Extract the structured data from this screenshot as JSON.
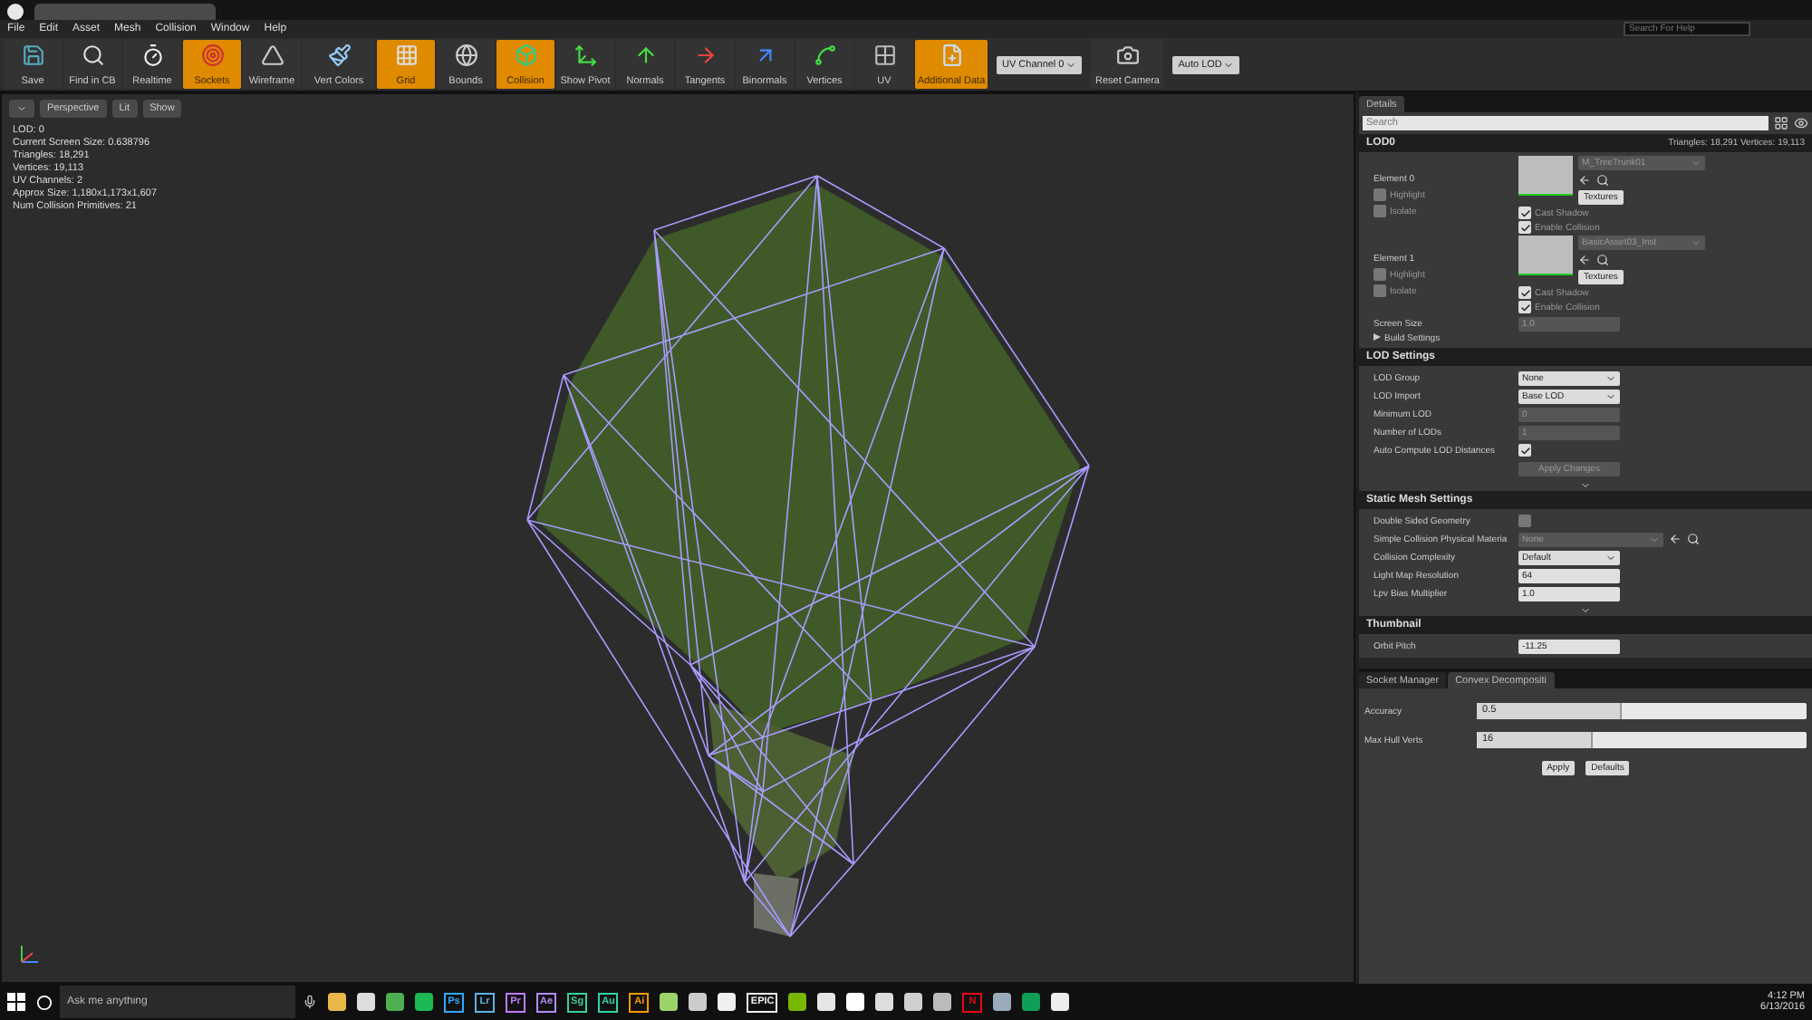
{
  "menu": [
    "File",
    "Edit",
    "Asset",
    "Mesh",
    "Collision",
    "Window",
    "Help"
  ],
  "help_search": {
    "placeholder": "Search For Help"
  },
  "toolbar": [
    {
      "kind": "button",
      "label": "Save",
      "selected": false
    },
    {
      "kind": "button",
      "label": "Find in CB",
      "selected": false
    },
    {
      "kind": "button",
      "label": "Realtime",
      "selected": false
    },
    {
      "kind": "button",
      "label": "Sockets",
      "selected": true
    },
    {
      "kind": "button",
      "label": "Wireframe",
      "selected": false
    },
    {
      "kind": "button",
      "label": "Vert Colors",
      "selected": false
    },
    {
      "kind": "button",
      "label": "Grid",
      "selected": true
    },
    {
      "kind": "button",
      "label": "Bounds",
      "selected": false
    },
    {
      "kind": "button",
      "label": "Collision",
      "selected": true
    },
    {
      "kind": "button",
      "label": "Show Pivot",
      "selected": false
    },
    {
      "kind": "button",
      "label": "Normals",
      "selected": false
    },
    {
      "kind": "button",
      "label": "Tangents",
      "selected": false
    },
    {
      "kind": "button",
      "label": "Binormals",
      "selected": false
    },
    {
      "kind": "button",
      "label": "Vertices",
      "selected": false
    },
    {
      "kind": "button",
      "label": "UV",
      "selected": false
    },
    {
      "kind": "button",
      "label": "Additional Data",
      "selected": true
    },
    {
      "kind": "dropdown",
      "label": "UV Channel 0"
    },
    {
      "kind": "button",
      "label": "Reset Camera",
      "selected": false
    },
    {
      "kind": "dropdown",
      "label": "Auto LOD"
    }
  ],
  "viewport": {
    "buttons": [
      "Perspective",
      "Lit",
      "Show"
    ],
    "stats": [
      "LOD:  0",
      "Current Screen Size:  0.638796",
      "Triangles:  18,291",
      "Vertices:  19,113",
      "UV Channels:  2",
      "Approx Size: 1,180x1,173x1,607",
      "Num Collision Primitives:  21"
    ]
  },
  "details": {
    "tab": "Details",
    "search": {
      "placeholder": "Search"
    },
    "lod0": {
      "title": "LOD0",
      "triangles": "Triangles:  18,291",
      "vertices": "Vertices:  19,113",
      "elements": [
        {
          "label": "Element 0",
          "material": "M_TreeTrunk01",
          "textures": "Textures",
          "highlight": {
            "label": "Highlight",
            "checked": false
          },
          "isolate": {
            "label": "Isolate",
            "checked": false
          },
          "cast_shadow": {
            "label": "Cast Shadow",
            "checked": true
          },
          "enable_collision": {
            "label": "Enable Collision",
            "checked": true
          }
        },
        {
          "label": "Element 1",
          "material": "BasicAsset03_Inst",
          "textures": "Textures",
          "highlight": {
            "label": "Highlight",
            "checked": false
          },
          "isolate": {
            "label": "Isolate",
            "checked": false
          },
          "cast_shadow": {
            "label": "Cast Shadow",
            "checked": true
          },
          "enable_collision": {
            "label": "Enable Collision",
            "checked": true
          }
        }
      ],
      "screen_size": {
        "label": "Screen Size",
        "value": "1.0"
      },
      "build_settings": {
        "label": "Build Settings",
        "expanded": false
      }
    },
    "sections": [
      {
        "title": "LOD Settings",
        "rows": [
          {
            "kind": "dropdown",
            "label": "LOD Group",
            "value": "None"
          },
          {
            "kind": "dropdown",
            "label": "LOD Import",
            "value": "Base LOD"
          },
          {
            "kind": "number",
            "label": "Minimum LOD",
            "value": "0",
            "disabled": true
          },
          {
            "kind": "number",
            "label": "Number of LODs",
            "value": "1",
            "disabled": true
          },
          {
            "kind": "checkbox",
            "label": "Auto Compute LOD Distances",
            "checked": true
          },
          {
            "kind": "action",
            "value": "Apply Changes",
            "disabled": true
          }
        ]
      },
      {
        "title": "Static Mesh Settings",
        "rows": [
          {
            "kind": "checkbox",
            "label": "Double Sided Geometry",
            "checked": false
          },
          {
            "kind": "asset",
            "label": "Simple Collision Physical Materia",
            "value": "None"
          },
          {
            "kind": "dropdown",
            "label": "Collision Complexity",
            "value": "Default"
          },
          {
            "kind": "number",
            "label": "Light Map Resolution",
            "value": "64",
            "disabled": false
          },
          {
            "kind": "number",
            "label": "Lpv Bias Multiplier",
            "value": "1.0",
            "disabled": false
          }
        ]
      },
      {
        "title": "Thumbnail",
        "rows": [
          {
            "kind": "number",
            "label": "Orbit Pitch",
            "value": "-11.25",
            "disabled": false
          }
        ]
      }
    ]
  },
  "bottom_tabs": [
    {
      "label": "Socket Manager",
      "selected": false
    },
    {
      "label": "Convex Decompositi",
      "selected": true
    }
  ],
  "convex": {
    "rows": [
      {
        "label": "Accuracy",
        "value": "0.5",
        "level": 0.44
      },
      {
        "label": "Max Hull Verts",
        "value": "16",
        "level": 0.35
      }
    ],
    "buttons": [
      "Apply",
      "Defaults"
    ]
  },
  "taskbar": {
    "search": {
      "placeholder": "Ask me anything"
    },
    "apps": [
      {
        "kind": "tile",
        "color": "#e8b84a"
      },
      {
        "kind": "tile",
        "color": "#dddddd"
      },
      {
        "kind": "tile",
        "color": "#4caf50"
      },
      {
        "kind": "tile",
        "color": "#1db954"
      },
      {
        "kind": "text",
        "label": "Ps",
        "color": "#31a8ff"
      },
      {
        "kind": "text",
        "label": "Lr",
        "color": "#5ab4e6"
      },
      {
        "kind": "text",
        "label": "Pr",
        "color": "#c27bff"
      },
      {
        "kind": "text",
        "label": "Ae",
        "color": "#b38cff"
      },
      {
        "kind": "text",
        "label": "Sg",
        "color": "#3ccf9a"
      },
      {
        "kind": "text",
        "label": "Au",
        "color": "#2fd3a8"
      },
      {
        "kind": "text",
        "label": "Ai",
        "color": "#ff9a00"
      },
      {
        "kind": "tile",
        "color": "#9bd36b"
      },
      {
        "kind": "tile",
        "color": "#cccccc"
      },
      {
        "kind": "tile",
        "color": "#f0f0f0"
      },
      {
        "kind": "text",
        "label": "EPIC",
        "color": "#eeeeee"
      },
      {
        "kind": "tile",
        "color": "#76b900"
      },
      {
        "kind": "tile",
        "color": "#e6e6e6"
      },
      {
        "kind": "tile",
        "color": "#ffffff"
      },
      {
        "kind": "tile",
        "color": "#dddddd"
      },
      {
        "kind": "tile",
        "color": "#cfcfcf"
      },
      {
        "kind": "tile",
        "color": "#bbbbbb"
      },
      {
        "kind": "text",
        "label": "N",
        "color": "#e50914"
      },
      {
        "kind": "tile",
        "color": "#9ab"
      },
      {
        "kind": "tile",
        "color": "#0f9d58"
      },
      {
        "kind": "tile",
        "color": "#eeeeee"
      }
    ],
    "time": "4:12 PM",
    "date": "6/13/2016"
  }
}
